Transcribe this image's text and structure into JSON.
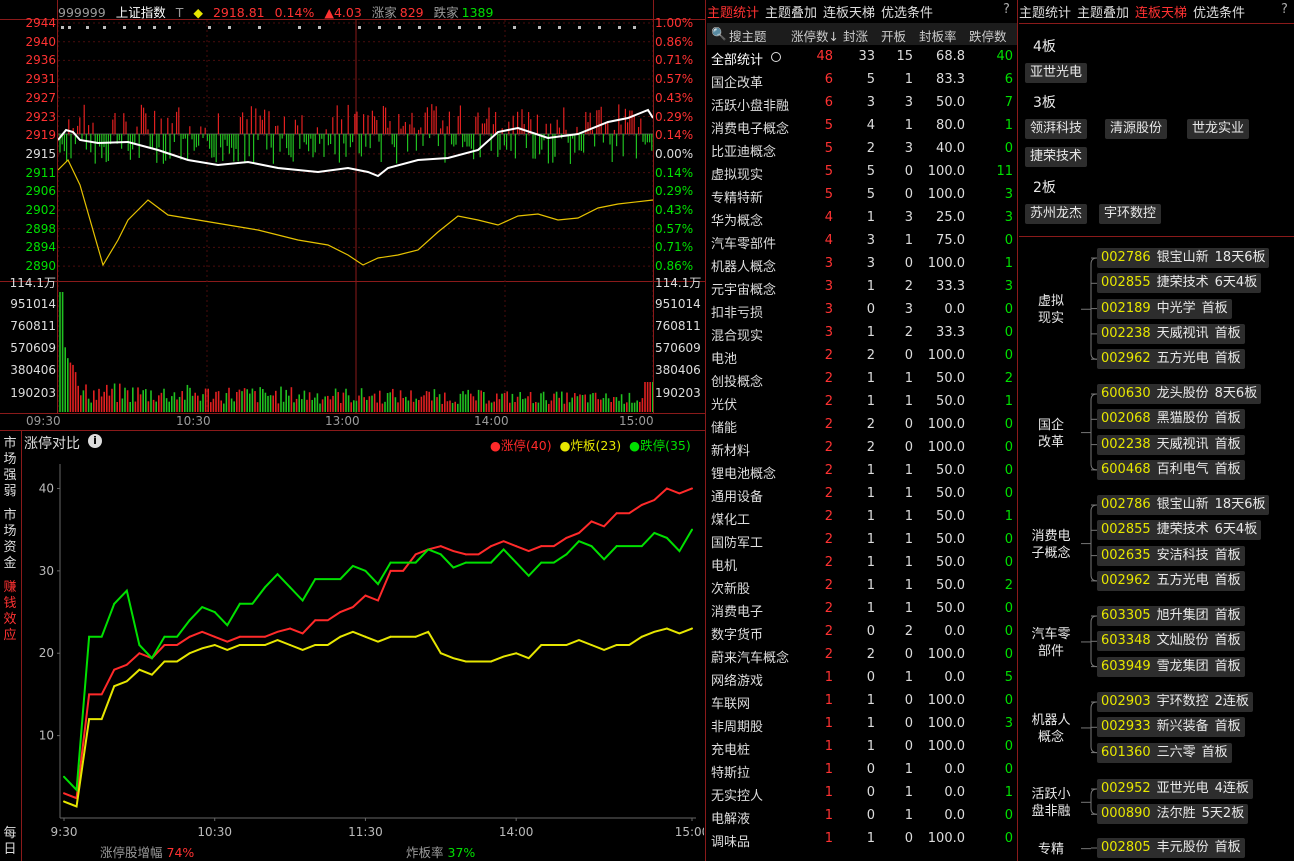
{
  "stock": {
    "code": "999999",
    "name": "上证指数",
    "mark": "T",
    "price": "2918.81",
    "pct": "0.14%",
    "change": "▲4.03",
    "up_label": "涨家",
    "up_count": "829",
    "down_label": "跌家",
    "down_count": "1389"
  },
  "price_axis": {
    "left": [
      "2944",
      "2940",
      "2936",
      "2931",
      "2927",
      "2923",
      "2919",
      "2915",
      "2911",
      "2906",
      "2902",
      "2898",
      "2894",
      "2890"
    ],
    "right": [
      "1.00%",
      "0.86%",
      "0.71%",
      "0.57%",
      "0.43%",
      "0.29%",
      "0.14%",
      "0.00%",
      "0.14%",
      "0.29%",
      "0.43%",
      "0.57%",
      "0.71%",
      "0.86%"
    ]
  },
  "vol_axis": {
    "left": [
      "114.1万",
      "951014",
      "760811",
      "570609",
      "380406",
      "190203"
    ],
    "right": [
      "114.1万",
      "951014",
      "760811",
      "570609",
      "380406",
      "190203"
    ]
  },
  "time_axis": [
    "09:30",
    "10:30",
    "13:00",
    "14:00",
    "15:00"
  ],
  "chart_data": [
    {
      "type": "line",
      "title": "涨停对比",
      "x": [
        "9:30",
        "10:30",
        "11:30",
        "14:00",
        "15:00"
      ],
      "ylim": [
        0,
        42
      ],
      "yticks": [
        10,
        20,
        30,
        40
      ],
      "legend": "top-right",
      "series": [
        {
          "name": "涨停(40)",
          "color": "#ff2a2a",
          "values": [
            3,
            15,
            18,
            20,
            21,
            22,
            22,
            22,
            22,
            23,
            24,
            25,
            27,
            30,
            32,
            33,
            32,
            33,
            33,
            33,
            34,
            36,
            37,
            38,
            40,
            40
          ]
        },
        {
          "name": "炸板(23)",
          "color": "#e6e600",
          "values": [
            2,
            12,
            16,
            18,
            19,
            20,
            21,
            21,
            21,
            21,
            21,
            22,
            22,
            22,
            22,
            20,
            19,
            19,
            20,
            21,
            21,
            21,
            21,
            22,
            23,
            23
          ]
        },
        {
          "name": "跌停(35)",
          "color": "#00e000",
          "values": [
            5,
            22,
            26,
            21,
            22,
            24,
            25,
            26,
            28,
            28,
            29,
            29,
            30,
            31,
            31,
            32,
            31,
            31,
            31,
            31,
            32,
            33,
            33,
            33,
            34,
            35
          ]
        }
      ]
    }
  ],
  "compare": {
    "title": "涨停对比",
    "legend": [
      {
        "label": "涨停(40)",
        "color": "#ff2a2a"
      },
      {
        "label": "炸板(23)",
        "color": "#e6e600"
      },
      {
        "label": "跌停(35)",
        "color": "#00e000"
      }
    ],
    "y_ticks": [
      "40",
      "30",
      "20",
      "10"
    ],
    "x_ticks": [
      "9:30",
      "10:30",
      "11:30",
      "14:00",
      "15:00"
    ],
    "footer_left_label": "涨停股增幅",
    "footer_left_value": "74%",
    "footer_right_label": "炸板率",
    "footer_right_value": "37%"
  },
  "side_tabs": [
    "市场强弱",
    "市场资金",
    "赚钱效应",
    "每日"
  ],
  "middle": {
    "tabs": [
      "主题统计",
      "主题叠加",
      "连板天梯",
      "优选条件"
    ],
    "active_tab": 0,
    "help": "?",
    "search": "搜主题",
    "columns": [
      "涨停数↓",
      "封涨",
      "开板",
      "封板率",
      "跌停数"
    ],
    "rows": [
      [
        "全部统计",
        "48",
        "33",
        "15",
        "68.8",
        "40"
      ],
      [
        "国企改革",
        "6",
        "5",
        "1",
        "83.3",
        "6"
      ],
      [
        "活跃小盘非融",
        "6",
        "3",
        "3",
        "50.0",
        "7"
      ],
      [
        "消费电子概念",
        "5",
        "4",
        "1",
        "80.0",
        "1"
      ],
      [
        "比亚迪概念",
        "5",
        "2",
        "3",
        "40.0",
        "0"
      ],
      [
        "虚拟现实",
        "5",
        "5",
        "0",
        "100.0",
        "11"
      ],
      [
        "专精特新",
        "5",
        "5",
        "0",
        "100.0",
        "3"
      ],
      [
        "华为概念",
        "4",
        "1",
        "3",
        "25.0",
        "3"
      ],
      [
        "汽车零部件",
        "4",
        "3",
        "1",
        "75.0",
        "0"
      ],
      [
        "机器人概念",
        "3",
        "3",
        "0",
        "100.0",
        "1"
      ],
      [
        "元宇宙概念",
        "3",
        "1",
        "2",
        "33.3",
        "3"
      ],
      [
        "扣非亏损",
        "3",
        "0",
        "3",
        "0.0",
        "0"
      ],
      [
        "混合现实",
        "3",
        "1",
        "2",
        "33.3",
        "0"
      ],
      [
        "电池",
        "2",
        "2",
        "0",
        "100.0",
        "0"
      ],
      [
        "创投概念",
        "2",
        "1",
        "1",
        "50.0",
        "2"
      ],
      [
        "光伏",
        "2",
        "1",
        "1",
        "50.0",
        "1"
      ],
      [
        "储能",
        "2",
        "2",
        "0",
        "100.0",
        "0"
      ],
      [
        "新材料",
        "2",
        "2",
        "0",
        "100.0",
        "0"
      ],
      [
        "锂电池概念",
        "2",
        "1",
        "1",
        "50.0",
        "0"
      ],
      [
        "通用设备",
        "2",
        "1",
        "1",
        "50.0",
        "0"
      ],
      [
        "煤化工",
        "2",
        "1",
        "1",
        "50.0",
        "1"
      ],
      [
        "国防军工",
        "2",
        "1",
        "1",
        "50.0",
        "0"
      ],
      [
        "电机",
        "2",
        "1",
        "1",
        "50.0",
        "0"
      ],
      [
        "次新股",
        "2",
        "1",
        "1",
        "50.0",
        "2"
      ],
      [
        "消费电子",
        "2",
        "1",
        "1",
        "50.0",
        "0"
      ],
      [
        "数字货币",
        "2",
        "0",
        "2",
        "0.0",
        "0"
      ],
      [
        "蔚来汽车概念",
        "2",
        "2",
        "0",
        "100.0",
        "0"
      ],
      [
        "网络游戏",
        "1",
        "0",
        "1",
        "0.0",
        "5"
      ],
      [
        "车联网",
        "1",
        "1",
        "0",
        "100.0",
        "0"
      ],
      [
        "非周期股",
        "1",
        "1",
        "0",
        "100.0",
        "3"
      ],
      [
        "充电桩",
        "1",
        "1",
        "0",
        "100.0",
        "0"
      ],
      [
        "特斯拉",
        "1",
        "0",
        "1",
        "0.0",
        "0"
      ],
      [
        "无实控人",
        "1",
        "0",
        "1",
        "0.0",
        "1"
      ],
      [
        "电解液",
        "1",
        "0",
        "1",
        "0.0",
        "0"
      ],
      [
        "调味品",
        "1",
        "1",
        "0",
        "100.0",
        "0"
      ]
    ]
  },
  "right": {
    "tabs": [
      "主题统计",
      "主题叠加",
      "连板天梯",
      "优选条件"
    ],
    "active_tab": 2,
    "help": "?",
    "boards": [
      {
        "label": "4板",
        "stocks": [
          "亚世光电"
        ]
      },
      {
        "label": "3板",
        "stocks": [
          "领湃科技",
          "清源股份",
          "世龙实业",
          "捷荣技术"
        ]
      },
      {
        "label": "2板",
        "stocks": [
          "苏州龙杰",
          "宇环数控"
        ]
      }
    ],
    "groups": [
      {
        "name": [
          "虚拟",
          "现实"
        ],
        "items": [
          [
            "002786",
            "银宝山新",
            "18天6板"
          ],
          [
            "002855",
            "捷荣技术",
            "6天4板"
          ],
          [
            "002189",
            "中光学",
            "首板"
          ],
          [
            "002238",
            "天威视讯",
            "首板"
          ],
          [
            "002962",
            "五方光电",
            "首板"
          ]
        ]
      },
      {
        "name": [
          "国企",
          "改革"
        ],
        "items": [
          [
            "600630",
            "龙头股份",
            "8天6板"
          ],
          [
            "002068",
            "黑猫股份",
            "首板"
          ],
          [
            "002238",
            "天威视讯",
            "首板"
          ],
          [
            "600468",
            "百利电气",
            "首板"
          ]
        ]
      },
      {
        "name": [
          "消费电",
          "子概念"
        ],
        "items": [
          [
            "002786",
            "银宝山新",
            "18天6板"
          ],
          [
            "002855",
            "捷荣技术",
            "6天4板"
          ],
          [
            "002635",
            "安洁科技",
            "首板"
          ],
          [
            "002962",
            "五方光电",
            "首板"
          ]
        ]
      },
      {
        "name": [
          "汽车零",
          "部件"
        ],
        "items": [
          [
            "603305",
            "旭升集团",
            "首板"
          ],
          [
            "603348",
            "文灿股份",
            "首板"
          ],
          [
            "603949",
            "雪龙集团",
            "首板"
          ]
        ]
      },
      {
        "name": [
          "机器人",
          "概念"
        ],
        "items": [
          [
            "002903",
            "宇环数控",
            "2连板"
          ],
          [
            "002933",
            "新兴装备",
            "首板"
          ],
          [
            "601360",
            "三六零",
            "首板"
          ]
        ]
      },
      {
        "name": [
          "活跃小",
          "盘非融"
        ],
        "items": [
          [
            "002952",
            "亚世光电",
            "4连板"
          ],
          [
            "000890",
            "法尔胜",
            "5天2板"
          ]
        ]
      },
      {
        "name": [
          "专精"
        ],
        "items": [
          [
            "002805",
            "丰元股份",
            "首板"
          ]
        ]
      }
    ]
  }
}
